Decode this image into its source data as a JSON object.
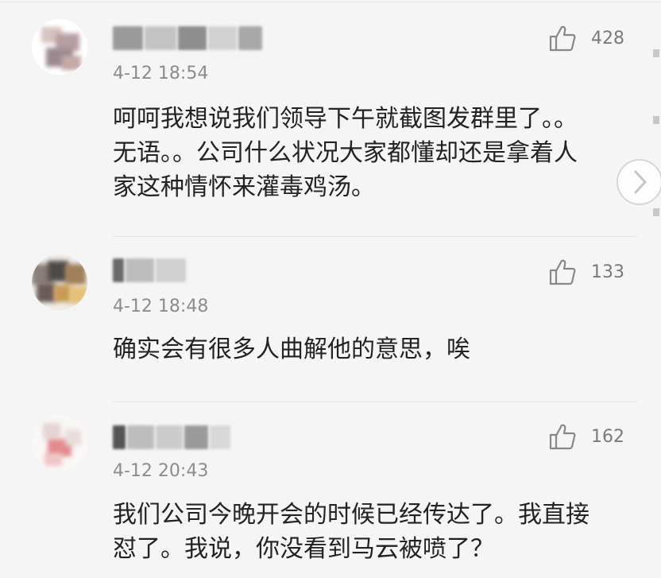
{
  "comments": [
    {
      "time": "4-12 18:54",
      "likes": "428",
      "text_lines": [
        "呵呵我想说我们领导下午就截图发群里了。。",
        "无语。。公司什么状况大家都懂却还是拿着人",
        "家这种情怀来灌毒鸡汤。"
      ]
    },
    {
      "time": "4-12 18:48",
      "likes": "133",
      "text_lines": [
        "确实会有很多人曲解他的意思，唉"
      ]
    },
    {
      "time": "4-12 20:43",
      "likes": "162",
      "text_lines": [
        "我们公司今晚开会的时候已经传达了。我直接",
        "怼了。我说，你没看到马云被喷了？"
      ]
    }
  ],
  "icons": {
    "like": "thumbs-up-icon",
    "next": "chevron-right-icon"
  },
  "colors": {
    "background": "#f5f5f5",
    "text": "#222222",
    "meta": "#8c8c8c"
  }
}
